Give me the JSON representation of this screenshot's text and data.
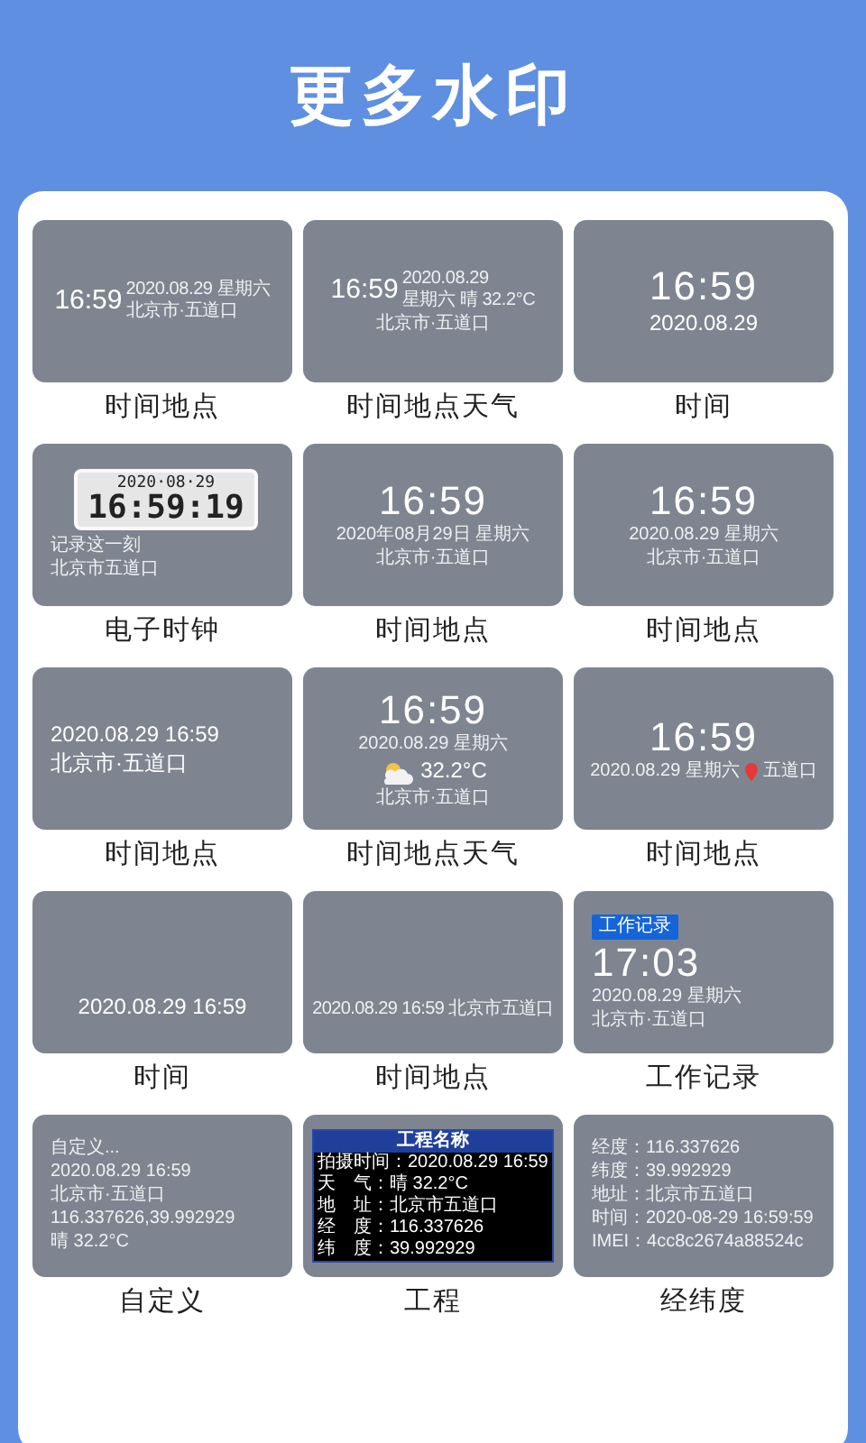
{
  "title": "更多水印",
  "tiles": [
    {
      "kind": "side",
      "label": "时间地点",
      "time": "16:59",
      "side": [
        "2020.08.29 星期六",
        "北京市·五道口"
      ]
    },
    {
      "kind": "side",
      "label": "时间地点天气",
      "time": "16:59",
      "side": [
        "2020.08.29",
        "星期六 晴 32.2°C"
      ],
      "lines": [
        {
          "kind": "small",
          "text": "北京市·五道口"
        }
      ]
    },
    {
      "kind": "center",
      "label": "时间",
      "lines": [
        {
          "kind": "time",
          "text": "16:59"
        },
        {
          "kind": "medium",
          "text": "2020.08.29"
        }
      ]
    },
    {
      "kind": "clock",
      "label": "电子时钟",
      "date": "2020·08·29",
      "time": "16:59:19",
      "lines": [
        {
          "kind": "small",
          "text": "记录这一刻"
        },
        {
          "kind": "small",
          "text": "北京市五道口"
        }
      ]
    },
    {
      "kind": "center",
      "label": "时间地点",
      "lines": [
        {
          "kind": "time",
          "text": "16:59"
        },
        {
          "kind": "small",
          "text": "2020年08月29日 星期六"
        },
        {
          "kind": "small",
          "text": "北京市·五道口"
        }
      ]
    },
    {
      "kind": "center",
      "label": "时间地点",
      "lines": [
        {
          "kind": "time",
          "text": "16:59"
        },
        {
          "kind": "small",
          "text": "2020.08.29 星期六"
        },
        {
          "kind": "small",
          "text": "北京市·五道口"
        }
      ]
    },
    {
      "kind": "left",
      "label": "时间地点",
      "lines": [
        {
          "kind": "medium",
          "text": "2020.08.29 16:59"
        },
        {
          "kind": "medium",
          "text": "北京市·五道口"
        }
      ]
    },
    {
      "kind": "center",
      "label": "时间地点天气",
      "lines": [
        {
          "kind": "time",
          "text": "16:59"
        },
        {
          "kind": "small",
          "text": "2020.08.29 星期六"
        },
        {
          "kind": "weather",
          "text": "32.2°C"
        },
        {
          "kind": "small",
          "text": "北京市·五道口"
        }
      ]
    },
    {
      "kind": "center",
      "label": "时间地点",
      "lines": [
        {
          "kind": "time",
          "text": "16:59"
        },
        {
          "kind": "pin",
          "text": "2020.08.29 星期六",
          "place": "五道口"
        }
      ]
    },
    {
      "kind": "bottom",
      "label": "时间",
      "lines": [
        {
          "kind": "medium",
          "text": "2020.08.29 16:59"
        }
      ]
    },
    {
      "kind": "bottom",
      "label": "时间地点",
      "lines": [
        {
          "kind": "small",
          "text": "2020.08.29 16:59 北京市五道口"
        }
      ]
    },
    {
      "kind": "left",
      "label": "工作记录",
      "lines": [
        {
          "kind": "tag",
          "text": "工作记录"
        },
        {
          "kind": "time",
          "text": "17:03"
        },
        {
          "kind": "small",
          "text": "2020.08.29 星期六"
        },
        {
          "kind": "small",
          "text": "北京市·五道口"
        }
      ]
    },
    {
      "kind": "left",
      "label": "自定义",
      "lines": [
        {
          "kind": "small",
          "text": "自定义..."
        },
        {
          "kind": "small",
          "text": "2020.08.29 16:59"
        },
        {
          "kind": "small",
          "text": "北京市·五道口"
        },
        {
          "kind": "small",
          "text": "116.337626,39.992929"
        },
        {
          "kind": "small",
          "text": "晴 32.2°C"
        }
      ]
    },
    {
      "kind": "project",
      "label": "工程",
      "heading": "工程名称",
      "rows": [
        "拍摄时间：2020.08.29 16:59",
        "天　气：晴 32.2°C",
        "地　址：北京市五道口",
        "经　度：116.337626",
        "纬　度：39.992929"
      ]
    },
    {
      "kind": "left",
      "label": "经纬度",
      "lines": [
        {
          "kind": "small",
          "text": "经度：116.337626"
        },
        {
          "kind": "small",
          "text": "纬度：39.992929"
        },
        {
          "kind": "small",
          "text": "地址：北京市五道口"
        },
        {
          "kind": "small",
          "text": "时间：2020-08-29 16:59:59"
        },
        {
          "kind": "small",
          "text": "IMEI：4cc8c2674a88524c"
        }
      ]
    }
  ]
}
